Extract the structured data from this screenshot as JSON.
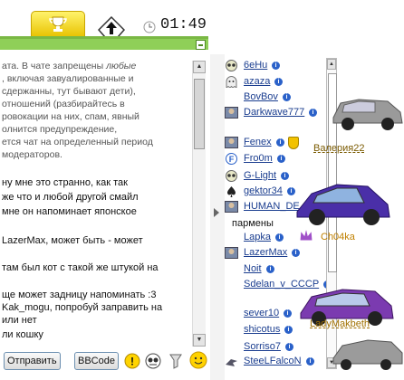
{
  "topbar": {
    "time": "01:49"
  },
  "chat": {
    "lines": [
      "ата. В чате запрещены любые",
      ", включая завуалированные и",
      "сдержанны, тут бывают дети),",
      "отношений (разбирайтесь в",
      "ровокации на них, спам, явный",
      "олнится предупреждение,",
      "ется чат на определенный период",
      "модераторов."
    ],
    "lines_italic_word": "любые",
    "messages": [
      "ну мне это странно, как так",
      "же что и любой другой смайл",
      "мне он напоминает японское",
      "LazerMax, может быть - может",
      "там был кот с такой же штукой на",
      "ще может задницу напоминать :3",
      "Kak_mogu, попробуй заправить на",
      "или нет",
      "ли кошку"
    ]
  },
  "toolbar": {
    "send_label": "Отправить",
    "bbcode_label": "BBCode"
  },
  "users": [
    {
      "name": "6eHu",
      "icon": "owl-icon"
    },
    {
      "name": "azaza",
      "icon": "ghost-icon"
    },
    {
      "name": "BovBov",
      "icon": ""
    },
    {
      "name": "Darkwave777",
      "icon": "avatar-icon"
    },
    {
      "name": "Fenex",
      "icon": "avatar-icon",
      "badge": "shield-icon"
    },
    {
      "name": "Fro0m",
      "icon": "f-circle-icon"
    },
    {
      "name": "G-Light",
      "icon": "owl-icon"
    },
    {
      "name": "gektor34",
      "icon": "spade-icon"
    },
    {
      "name": "HUMAN_DE",
      "icon": "avatar-icon"
    },
    {
      "name": "Lapka",
      "icon": ""
    },
    {
      "name": "LazerMax",
      "icon": "avatar-icon"
    },
    {
      "name": "Noit",
      "icon": ""
    },
    {
      "name": "Sdelan_v_CCCP",
      "icon": ""
    },
    {
      "name": "sever10",
      "icon": ""
    },
    {
      "name": "shicotus",
      "icon": ""
    },
    {
      "name": "Sorriso7",
      "icon": ""
    },
    {
      "name": "SteeLFalcoN",
      "icon": "bird-icon"
    }
  ],
  "overlays": {
    "car1_label": "Валерия22",
    "car2_label": "пармены",
    "car3_label": "Ch04ka",
    "car4_label": "LadyMakbeth"
  },
  "colors": {
    "accent_green": "#8fcf58",
    "link_blue": "#1a3d8f",
    "trophy_gold": "#f0d000"
  }
}
